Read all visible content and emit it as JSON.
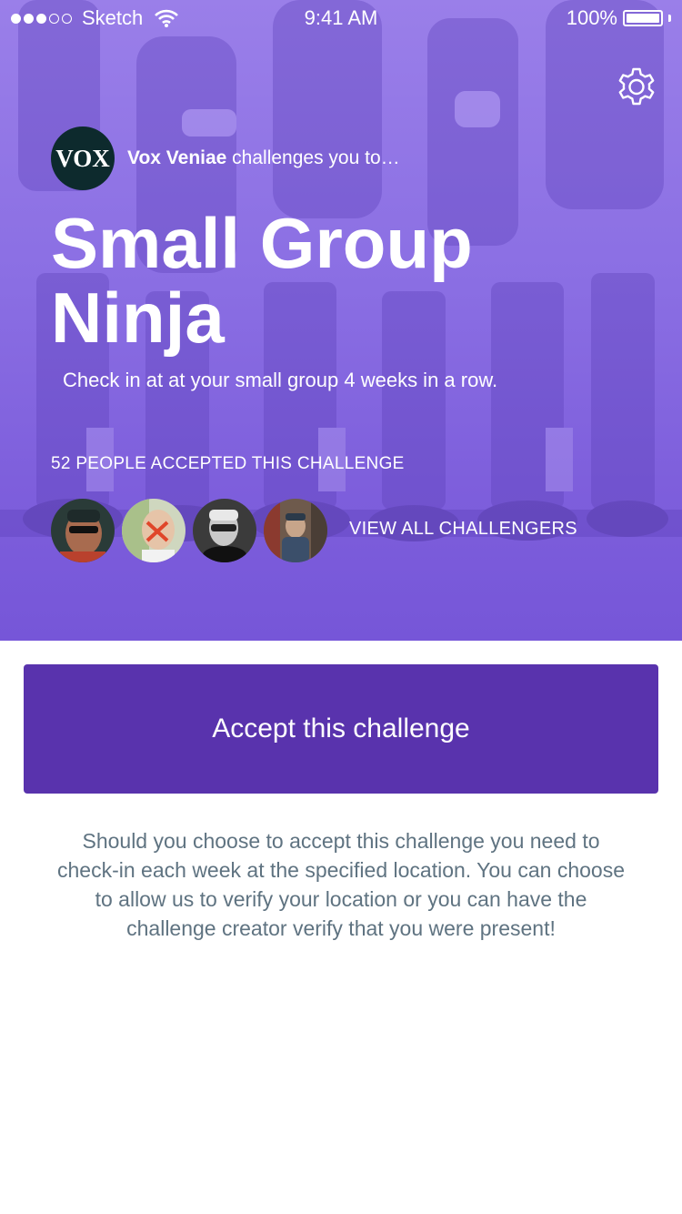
{
  "status_bar": {
    "carrier": "Sketch",
    "time": "9:41 AM",
    "battery": "100%",
    "signal_bars_filled": 3,
    "signal_bars_total": 5
  },
  "header": {
    "settings_icon": "gear-icon"
  },
  "challenge": {
    "challenger_logo": "VOX",
    "challenger_name": "Vox Veniae",
    "challenger_suffix": " challenges you to…",
    "title": "Small Group Ninja",
    "subtitle": "Check in at at your small group 4 weeks in a row.",
    "accepted_text": "52 PEOPLE ACCEPTED THIS CHALLENGE",
    "view_all_label": "VIEW ALL CHALLENGERS"
  },
  "actions": {
    "accept_label": "Accept this challenge"
  },
  "description": "Should you choose to accept this challenge you need to check-in each week at the specified location. You can choose to allow us to verify your location or you can have the challenge creator verify that you were present!",
  "colors": {
    "hero_top": "#9a7fe9",
    "hero_bottom": "#7656d8",
    "button": "#5933ad",
    "body_text": "#5f7381"
  }
}
